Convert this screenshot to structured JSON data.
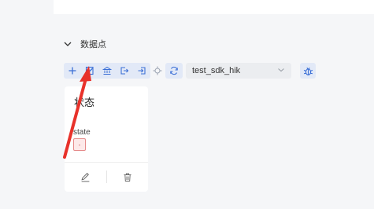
{
  "section": {
    "title": "数据点",
    "collapse_icon": "chevron-down-icon"
  },
  "toolbar": {
    "buttons": [
      {
        "name": "add",
        "icon": "plus-icon"
      },
      {
        "name": "edit",
        "icon": "edit-icon"
      },
      {
        "name": "bank",
        "icon": "bank-icon"
      },
      {
        "name": "export",
        "icon": "export-icon"
      },
      {
        "name": "import",
        "icon": "import-icon"
      },
      {
        "name": "locate",
        "icon": "crosshair-icon"
      },
      {
        "name": "refresh",
        "icon": "refresh-icon"
      }
    ],
    "device_select": {
      "value": "test_sdk_hik"
    },
    "debug_icon": "bug-icon"
  },
  "card": {
    "title": "状态",
    "field_label": "state",
    "field_value": "-",
    "edit_icon": "pencil-icon",
    "delete_icon": "trash-icon"
  },
  "colors": {
    "accent": "#3b6fd6",
    "annotation_arrow": "#e8322b",
    "toolbar_bg": "#e2e9f7"
  }
}
